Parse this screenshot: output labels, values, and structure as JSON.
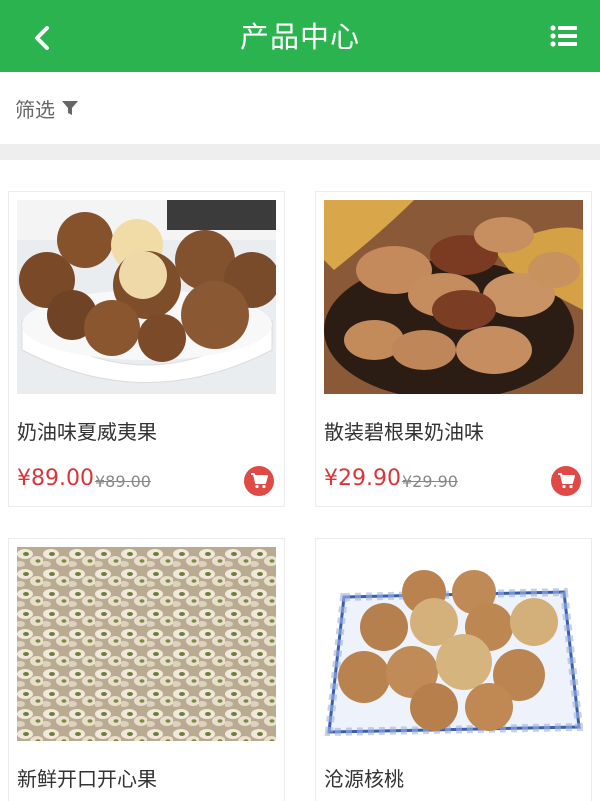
{
  "header": {
    "title": "产品中心"
  },
  "filter": {
    "label": "筛选"
  },
  "products": [
    {
      "name": "奶油味夏威夷果",
      "price": "¥89.00",
      "old_price": "¥89.00",
      "image": "macadamia-nuts-photo"
    },
    {
      "name": "散装碧根果奶油味",
      "price": "¥29.90",
      "old_price": "¥29.90",
      "image": "pecan-nuts-photo"
    },
    {
      "name": "新鲜开口开心果",
      "price": "",
      "old_price": "",
      "image": "pistachios-photo"
    },
    {
      "name": "沧源核桃",
      "price": "",
      "old_price": "",
      "image": "walnuts-photo"
    }
  ],
  "colors": {
    "brand": "#2ab34f",
    "price": "#d9363a",
    "cart": "#e04a46"
  },
  "icons": {
    "back": "chevron-left-icon",
    "menu": "list-menu-icon",
    "filter": "funnel-icon",
    "cart": "shopping-cart-icon"
  }
}
